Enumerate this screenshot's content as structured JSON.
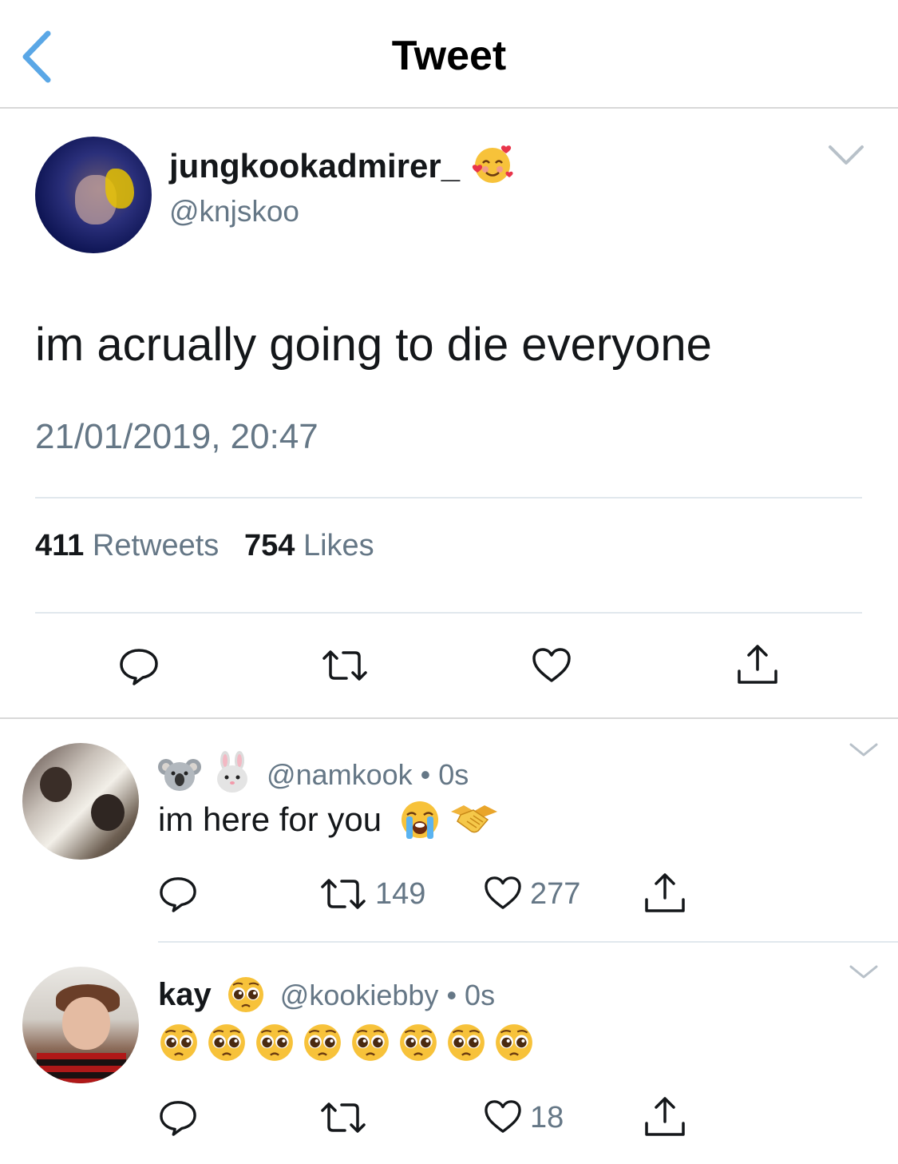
{
  "nav": {
    "title": "Tweet"
  },
  "tweet": {
    "display_name": "jungkookadmirer_",
    "name_emoji": "smiling-face-with-hearts",
    "handle": "@knjskoo",
    "text": "im acrually going to die everyone",
    "timestamp": "21/01/2019, 20:47",
    "retweets_count": "411",
    "retweets_label": "Retweets",
    "likes_count": "754",
    "likes_label": "Likes"
  },
  "replies": [
    {
      "name_emojis": [
        "koala",
        "rabbit-face"
      ],
      "handle": "@namkook",
      "time": "• 0s",
      "text": "im here for you",
      "text_emojis": [
        "loudly-crying-face",
        "handshake"
      ],
      "retweets": "149",
      "likes": "277"
    },
    {
      "display_name": "kay",
      "name_emoji": "pleading-face",
      "handle": "@kookiebby",
      "time": "• 0s",
      "text_emojis": [
        "pleading-face",
        "pleading-face",
        "pleading-face",
        "pleading-face",
        "pleading-face",
        "pleading-face",
        "pleading-face",
        "pleading-face"
      ],
      "retweets": "",
      "likes": "18"
    }
  ],
  "colors": {
    "accent": "#1da1f2",
    "back_chevron": "#5aa7e6",
    "secondary_text": "#657786",
    "divider": "#e1e8ed",
    "icon": "#14171a"
  }
}
